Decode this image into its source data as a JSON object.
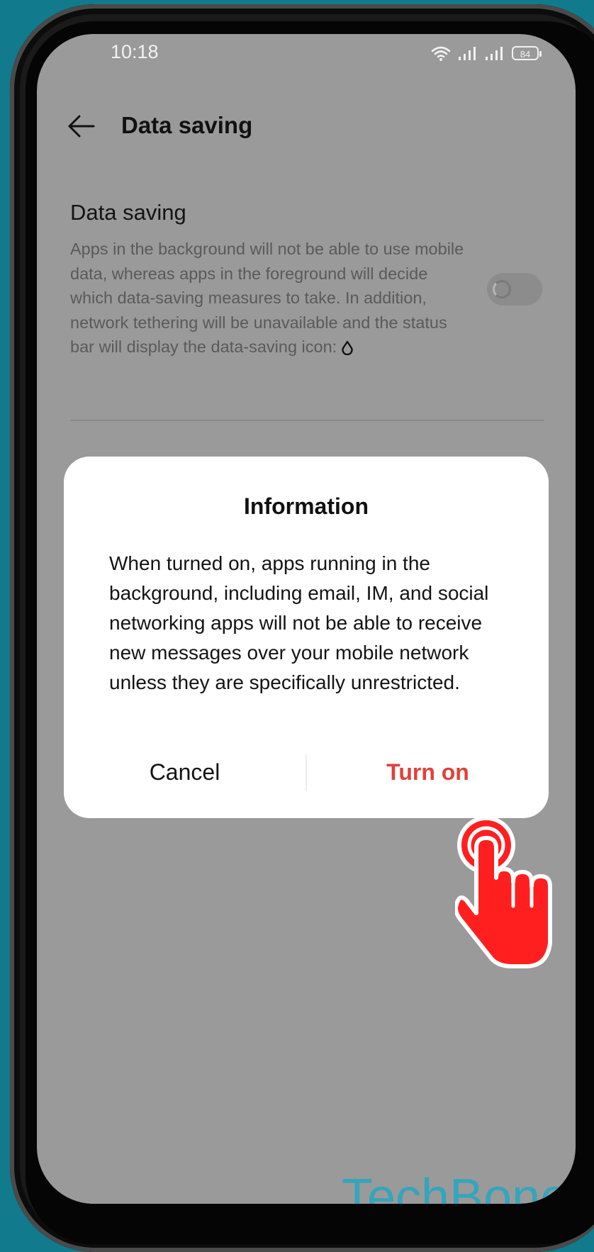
{
  "status_bar": {
    "time": "10:18",
    "battery": "84"
  },
  "header": {
    "title": "Data saving"
  },
  "setting": {
    "title": "Data saving",
    "description": "Apps in the background will not be able to use mobile data, whereas apps in the foreground will decide which data-saving measures to take. In addition, network tethering will be unavailable and the status bar will display the data-saving icon:",
    "toggle_on": false
  },
  "dialog": {
    "title": "Information",
    "message": "When turned on, apps running in the background, including email, IM, and social networking apps will not be able to receive new messages over your mobile network unless they are specifically unrestricted.",
    "cancel_label": "Cancel",
    "confirm_label": "Turn on"
  },
  "watermark": "TechBone",
  "colors": {
    "background": "#117a8c",
    "accent": "#e2403a",
    "hand": "#ff1f1f",
    "watermark": "#2aa7c0"
  }
}
